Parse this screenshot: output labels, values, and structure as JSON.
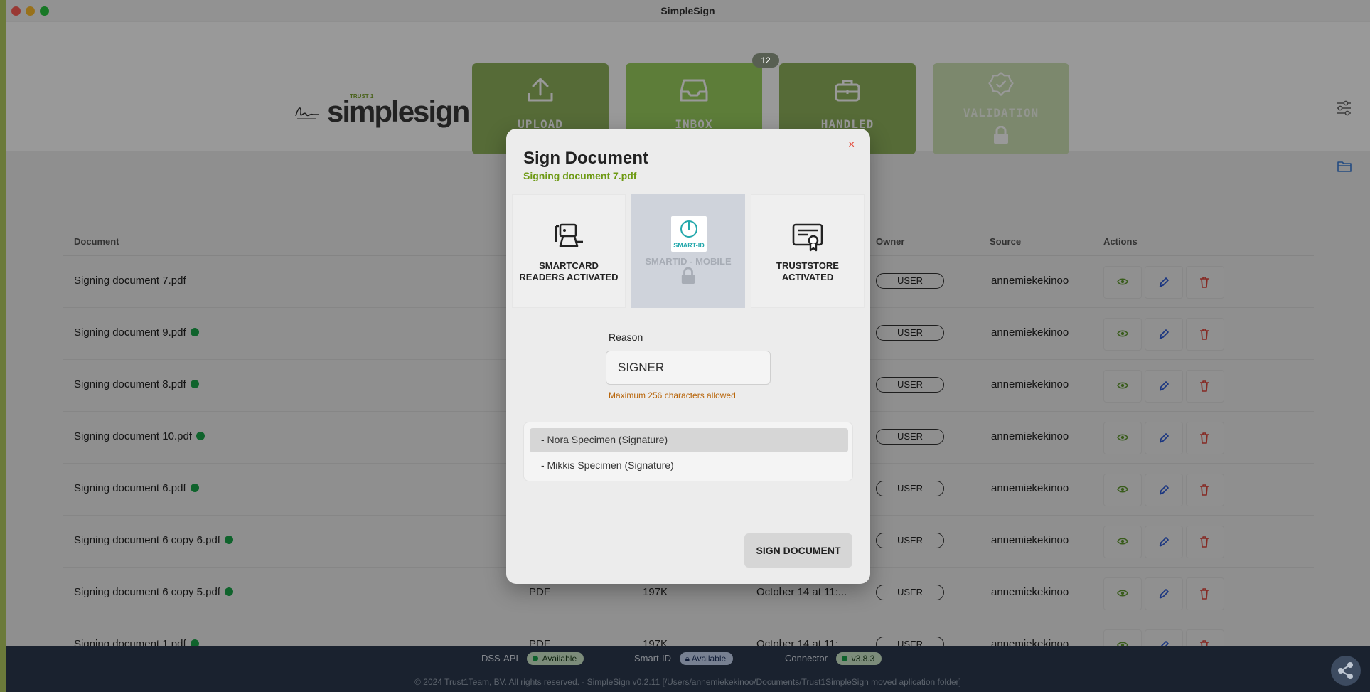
{
  "window": {
    "title": "SimpleSign"
  },
  "logo": {
    "trust": "TRUST 1",
    "brand": "simplesign"
  },
  "nav": {
    "upload": "UPLOAD",
    "inbox": "INBOX",
    "inbox_badge": "12",
    "handled": "HANDLED",
    "validation": "VALIDATION"
  },
  "table": {
    "headers": {
      "document": "Document",
      "owner": "Owner",
      "source": "Source",
      "actions": "Actions"
    },
    "rows": [
      {
        "name": "Signing document 7.pdf",
        "type": "",
        "size": "",
        "date": "",
        "owner": "USER",
        "source": "annemiekekinoo",
        "dot": false
      },
      {
        "name": "Signing document 9.pdf",
        "type": "",
        "size": "",
        "date": "",
        "owner": "USER",
        "source": "annemiekekinoo",
        "dot": true
      },
      {
        "name": "Signing document 8.pdf",
        "type": "",
        "size": "",
        "date": "",
        "owner": "USER",
        "source": "annemiekekinoo",
        "dot": true
      },
      {
        "name": "Signing document 10.pdf",
        "type": "",
        "size": "",
        "date": "",
        "owner": "USER",
        "source": "annemiekekinoo",
        "dot": true
      },
      {
        "name": "Signing document 6.pdf",
        "type": "",
        "size": "",
        "date": "",
        "owner": "USER",
        "source": "annemiekekinoo",
        "dot": true
      },
      {
        "name": "Signing document 6 copy 6.pdf",
        "type": "",
        "size": "",
        "date": "",
        "owner": "USER",
        "source": "annemiekekinoo",
        "dot": true
      },
      {
        "name": "Signing document 6 copy 5.pdf",
        "type": "PDF",
        "size": "197K",
        "date": "October 14 at 11:...",
        "owner": "USER",
        "source": "annemiekekinoo",
        "dot": true
      },
      {
        "name": "Signing document 1.pdf",
        "type": "PDF",
        "size": "197K",
        "date": "October 14 at 11:...",
        "owner": "USER",
        "source": "annemiekekinoo",
        "dot": true
      }
    ]
  },
  "footer": {
    "dss_label": "DSS-API",
    "dss_status": "Available",
    "smartid_label": "Smart-ID",
    "smartid_status": "Available",
    "connector_label": "Connector",
    "connector_version": "v3.8.3",
    "copyright": "© 2024 Trust1Team, BV. All rights reserved. - SimpleSign v0.2.11 [/Users/annemiekekinoo/Documents/Trust1SimpleSign moved aplication folder]"
  },
  "modal": {
    "close": "×",
    "title": "Sign Document",
    "subtitle": "Signing document 7.pdf",
    "options": {
      "smartcard": "SMARTCARD READERS ACTIVATED",
      "smartid": "SMARTID - MOBILE",
      "smartid_logo": "SMART-ID",
      "truststore": "TRUSTSTORE ACTIVATED"
    },
    "reason_label": "Reason",
    "reason_value": "SIGNER",
    "hint": "Maximum 256 characters allowed",
    "certs": [
      "- Nora Specimen (Signature)",
      "- Mikkis Specimen (Signature)"
    ],
    "sign_button": "SIGN DOCUMENT"
  },
  "colors": {
    "accent_green": "#9bd15f",
    "subtitle_green": "#6e9a14",
    "hint_orange": "#b8650a",
    "footer_bg": "#2c3a4f",
    "status_dot": "#19a64a"
  },
  "icons": [
    "upload-icon",
    "inbox-icon",
    "briefcase-icon",
    "verified-badge-icon",
    "lock-icon",
    "settings-sliders-icon",
    "folder-icon",
    "eye-icon",
    "pen-icon",
    "trash-icon",
    "smartcard-reader-icon",
    "certificate-icon",
    "share-icon",
    "close-icon"
  ]
}
